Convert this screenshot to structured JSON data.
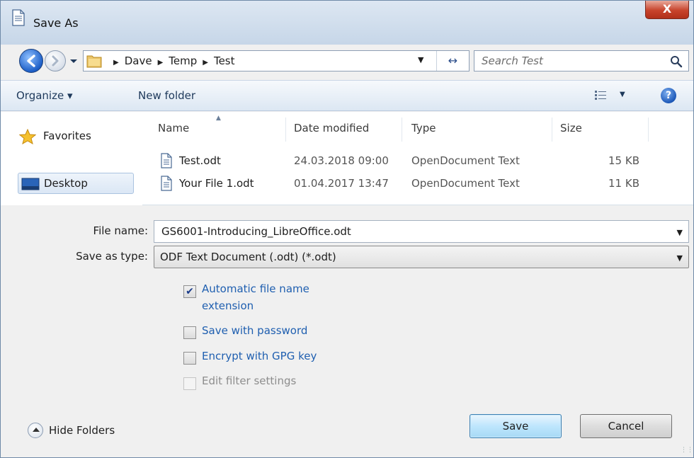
{
  "window": {
    "title": "Save As",
    "close_glyph": "X"
  },
  "address": {
    "crumbs": [
      "Dave",
      "Temp",
      "Test"
    ],
    "search_placeholder": "Search Test"
  },
  "toolbar": {
    "organize": "Organize ▾",
    "new_folder": "New folder",
    "help_glyph": "?"
  },
  "nav": {
    "favorites": "Favorites",
    "desktop": "Desktop"
  },
  "columns": {
    "name": "Name",
    "date": "Date modified",
    "type": "Type",
    "size": "Size"
  },
  "files": [
    {
      "name": "Test.odt",
      "date": "24.03.2018 09:00",
      "type": "OpenDocument Text",
      "size": "15 KB"
    },
    {
      "name": "Your File 1.odt",
      "date": "01.04.2017 13:47",
      "type": "OpenDocument Text",
      "size": "11 KB"
    }
  ],
  "form": {
    "file_name_label": "File name:",
    "file_name_value": "GS6001-Introducing_LibreOffice.odt",
    "save_type_label": "Save as type:",
    "save_type_value": "ODF Text Document (.odt) (*.odt)",
    "options": [
      {
        "label_line1": "Automatic file name",
        "label_line2": "extension",
        "checked": true,
        "enabled": true
      },
      {
        "label": "Save with password",
        "checked": false,
        "enabled": true
      },
      {
        "label": "Encrypt with GPG key",
        "checked": false,
        "enabled": true
      },
      {
        "label": "Edit filter settings",
        "checked": false,
        "enabled": false
      }
    ],
    "check_glyph": "✔"
  },
  "footer": {
    "hide_folders": "Hide Folders",
    "save": "Save",
    "cancel": "Cancel"
  },
  "colors": {
    "link_blue": "#1f5fb0",
    "title_gradient_top": "#dde7f2",
    "close_red": "#c7432b"
  }
}
